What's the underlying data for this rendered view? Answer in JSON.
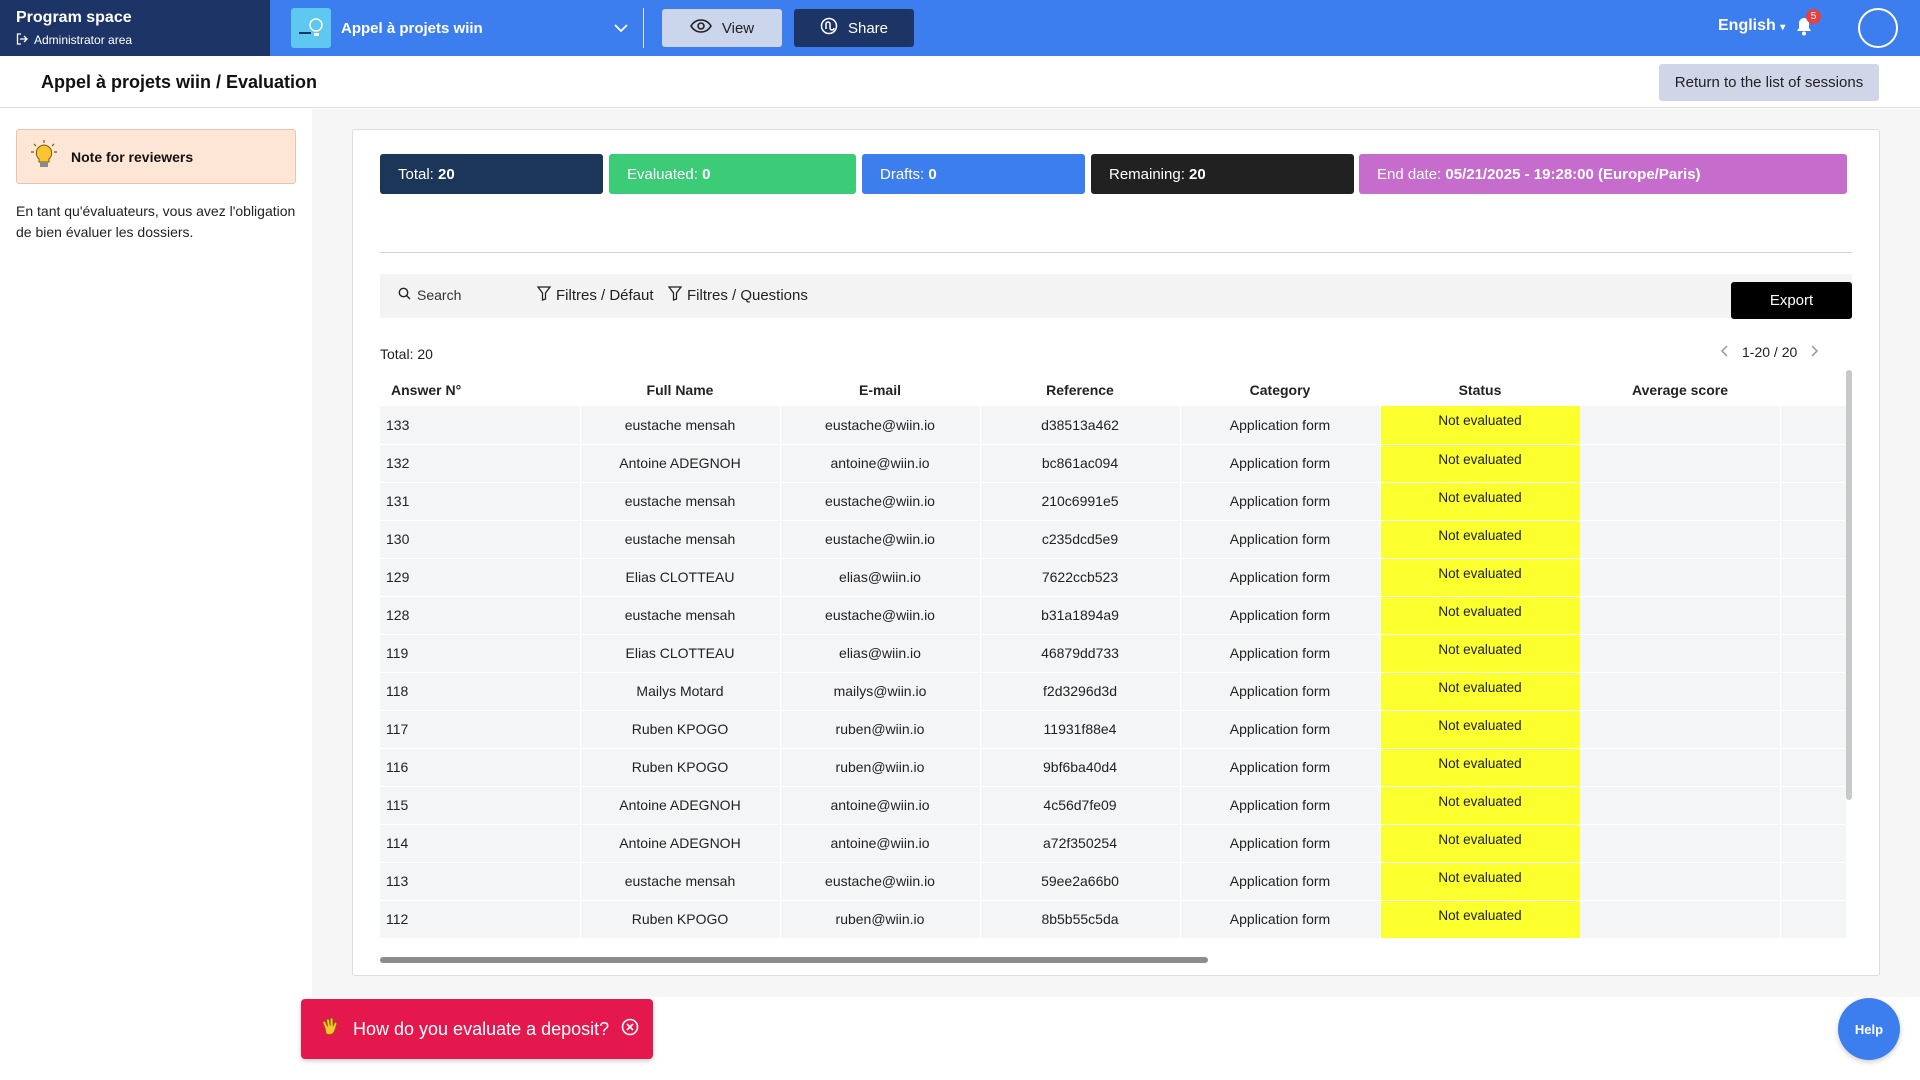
{
  "colors": {
    "topbar": "#3d7eee",
    "navy": "#1d3566",
    "status_not_evaluated": "#fbff2e",
    "deposit": "#e5184d"
  },
  "header": {
    "program_title": "Program space",
    "admin_link": "Administrator area",
    "project_name": "Appel à projets wiin",
    "view_label": "View",
    "share_label": "Share",
    "language": "English",
    "notification_count": "5"
  },
  "titlebar": {
    "title": "Appel à projets wiin / Evaluation",
    "return_label": "Return to the list of sessions"
  },
  "sidebar": {
    "note_title": "Note for reviewers",
    "note_text": "En tant qu'évaluateurs, vous avez l'obligation de bien évaluer les dossiers."
  },
  "stats": {
    "total_label": "Total:",
    "total_value": "20",
    "evaluated_label": "Evaluated:",
    "evaluated_value": "0",
    "drafts_label": "Drafts:",
    "drafts_value": "0",
    "remaining_label": "Remaining:",
    "remaining_value": "20",
    "end_label": "End date:",
    "end_value": "05/21/2025 - 19:28:00 (Europe/Paris)"
  },
  "toolbar": {
    "search_placeholder": "Search",
    "filter_default": "Filtres / Défaut",
    "filter_questions": "Filtres / Questions",
    "export_label": "Export"
  },
  "table": {
    "total_text": "Total: 20",
    "pagination": "1-20 / 20",
    "columns": [
      "Answer N°",
      "Full Name",
      "E-mail",
      "Reference",
      "Category",
      "Status",
      "Average score"
    ],
    "rows": [
      [
        "133",
        "eustache mensah",
        "eustache@wiin.io",
        "d38513a462",
        "Application form",
        "Not evaluated",
        ""
      ],
      [
        "132",
        "Antoine ADEGNOH",
        "antoine@wiin.io",
        "bc861ac094",
        "Application form",
        "Not evaluated",
        ""
      ],
      [
        "131",
        "eustache mensah",
        "eustache@wiin.io",
        "210c6991e5",
        "Application form",
        "Not evaluated",
        ""
      ],
      [
        "130",
        "eustache mensah",
        "eustache@wiin.io",
        "c235dcd5e9",
        "Application form",
        "Not evaluated",
        ""
      ],
      [
        "129",
        "Elias CLOTTEAU",
        "elias@wiin.io",
        "7622ccb523",
        "Application form",
        "Not evaluated",
        ""
      ],
      [
        "128",
        "eustache mensah",
        "eustache@wiin.io",
        "b31a1894a9",
        "Application form",
        "Not evaluated",
        ""
      ],
      [
        "119",
        "Elias CLOTTEAU",
        "elias@wiin.io",
        "46879dd733",
        "Application form",
        "Not evaluated",
        ""
      ],
      [
        "118",
        "Mailys Motard",
        "mailys@wiin.io",
        "f2d3296d3d",
        "Application form",
        "Not evaluated",
        ""
      ],
      [
        "117",
        "Ruben KPOGO",
        "ruben@wiin.io",
        "11931f88e4",
        "Application form",
        "Not evaluated",
        ""
      ],
      [
        "116",
        "Ruben KPOGO",
        "ruben@wiin.io",
        "9bf6ba40d4",
        "Application form",
        "Not evaluated",
        ""
      ],
      [
        "115",
        "Antoine ADEGNOH",
        "antoine@wiin.io",
        "4c56d7fe09",
        "Application form",
        "Not evaluated",
        ""
      ],
      [
        "114",
        "Antoine ADEGNOH",
        "antoine@wiin.io",
        "a72f350254",
        "Application form",
        "Not evaluated",
        ""
      ],
      [
        "113",
        "eustache mensah",
        "eustache@wiin.io",
        "59ee2a66b0",
        "Application form",
        "Not evaluated",
        ""
      ],
      [
        "112",
        "Ruben KPOGO",
        "ruben@wiin.io",
        "8b5b55c5da",
        "Application form",
        "Not evaluated",
        ""
      ]
    ]
  },
  "footer": {
    "deposit_label": "How do you evaluate a deposit?",
    "help_label": "Help"
  }
}
